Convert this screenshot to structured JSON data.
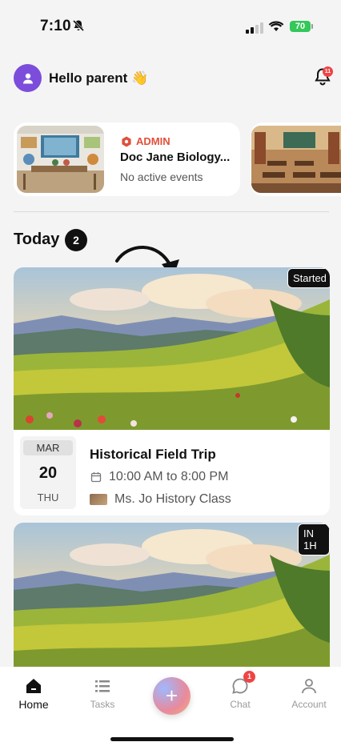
{
  "status_bar": {
    "time": "7:10",
    "battery": "70"
  },
  "header": {
    "greeting": "Hello parent 👋",
    "notification_count": "11"
  },
  "class_cards": [
    {
      "role": "ADMIN",
      "name": "Doc Jane Biology...",
      "status": "No active events"
    }
  ],
  "today": {
    "label": "Today",
    "count": "2"
  },
  "events": [
    {
      "status": "Started",
      "month": "MAR",
      "day": "20",
      "weekday": "THU",
      "title": "Historical Field Trip",
      "time": "10:00 AM to 8:00 PM",
      "class_name": "Ms. Jo History Class"
    },
    {
      "status": "IN 1H"
    }
  ],
  "tabbar": {
    "home": "Home",
    "tasks": "Tasks",
    "chat": "Chat",
    "chat_badge": "1",
    "account": "Account",
    "fab_label": "+"
  },
  "colors": {
    "accent": "#7c4ddb",
    "admin": "#e0503a",
    "badge": "#ef4444"
  }
}
